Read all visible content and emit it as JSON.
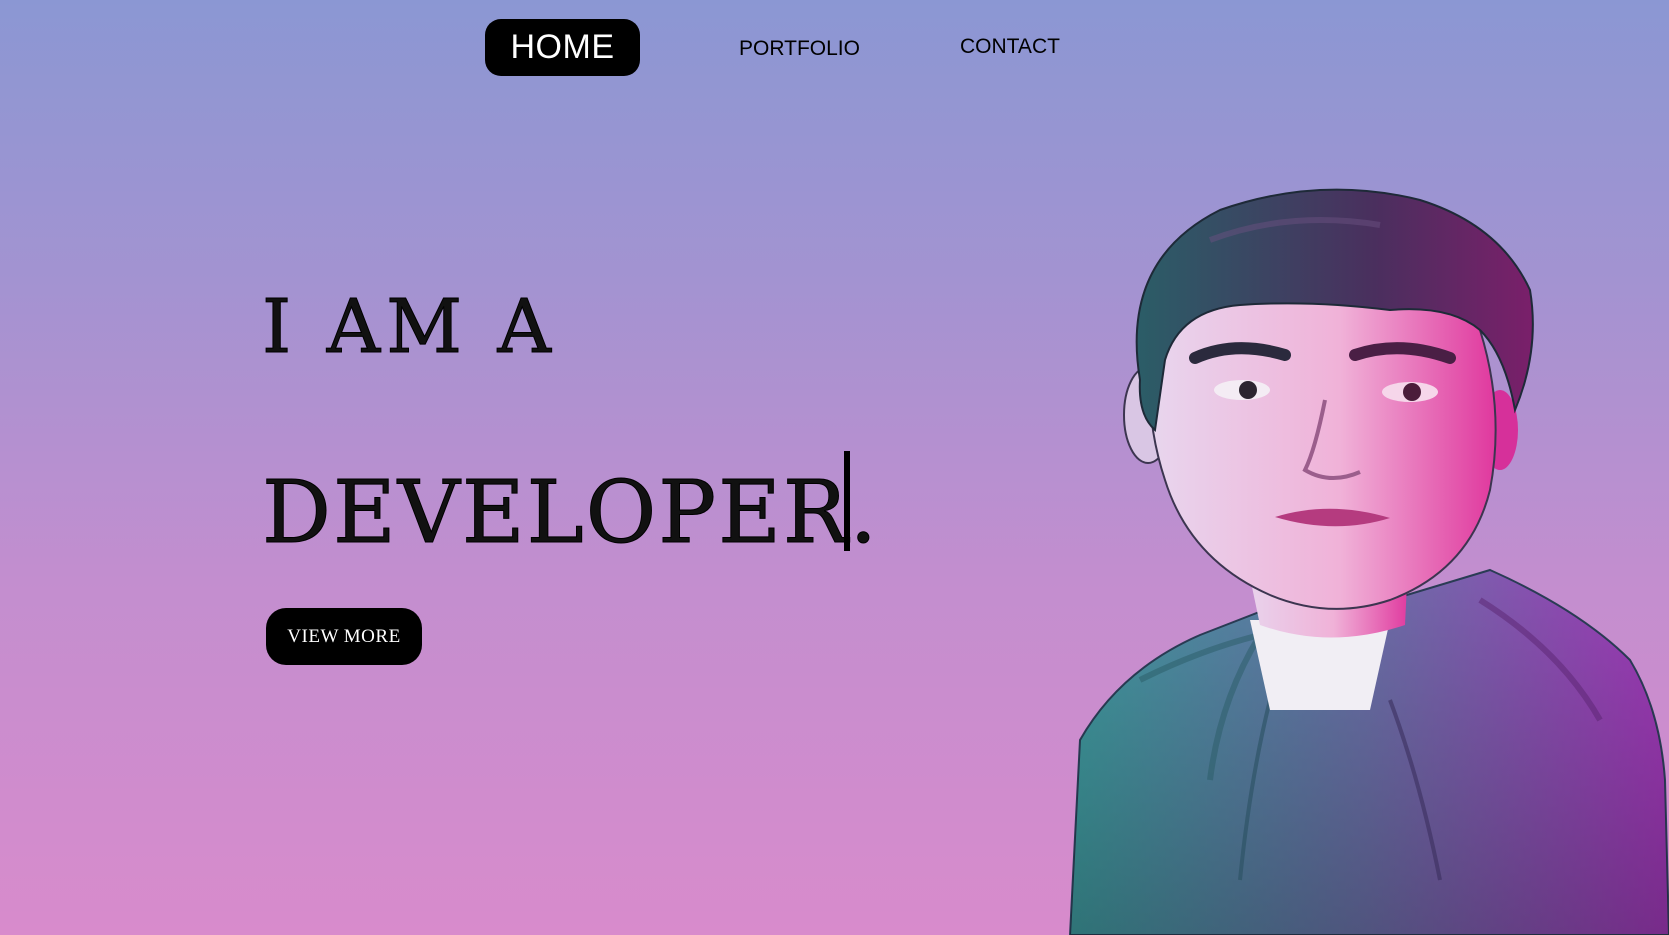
{
  "nav": {
    "home_label": "HOME",
    "portfolio_label": "PORTFOLIO",
    "contact_label": "CONTACT"
  },
  "hero": {
    "line1": "I AM A",
    "line2": "DEVELOPER.",
    "cta_label": "VIEW MORE"
  },
  "colors": {
    "gradient_top": "#8b97d3",
    "gradient_bottom": "#d88bcc",
    "button_bg": "#000000",
    "button_text": "#ffffff"
  },
  "icons": {
    "text_cursor": "text-cursor-bar",
    "portrait": "person-portrait"
  }
}
